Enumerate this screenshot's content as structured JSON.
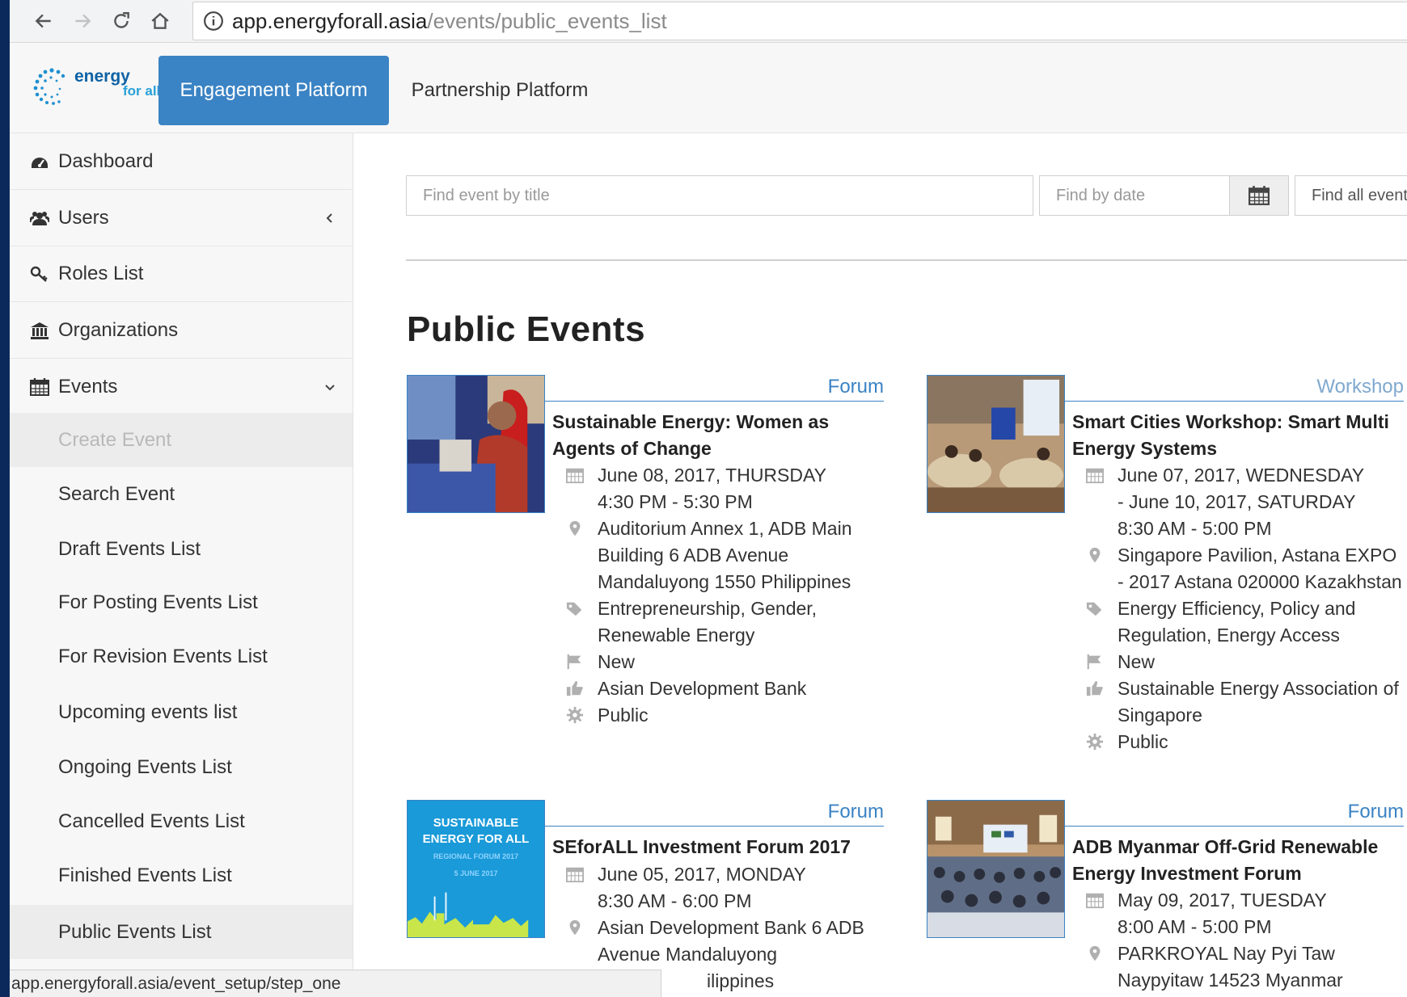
{
  "browser": {
    "url_host": "app.energyforall.asia",
    "url_path": "/events/public_events_list"
  },
  "topnav": {
    "logo_line1": "energy",
    "logo_line2": "for all",
    "tabs": [
      {
        "label": "Engagement Platform",
        "active": true
      },
      {
        "label": "Partnership Platform",
        "active": false
      }
    ]
  },
  "sidebar": {
    "items": [
      {
        "label": "Dashboard",
        "icon": "dashboard-icon"
      },
      {
        "label": "Users",
        "icon": "users-icon"
      },
      {
        "label": "Roles List",
        "icon": "key-icon"
      },
      {
        "label": "Organizations",
        "icon": "bank-icon"
      },
      {
        "label": "Events",
        "icon": "calendar-icon"
      }
    ],
    "events_sub": [
      "Create Event",
      "Search Event",
      "Draft Events List",
      "For Posting Events List",
      "For Revision Events List",
      "Upcoming events list",
      "Ongoing Events List",
      "Cancelled Events List",
      "Finished Events List",
      "Public Events List"
    ]
  },
  "filters": {
    "title_placeholder": "Find event by title",
    "date_placeholder": "Find by date",
    "all_events_label": "Find all event t"
  },
  "page": {
    "title": "Public Events"
  },
  "events": [
    {
      "category": "Forum",
      "title": "Sustainable Energy: Women as Agents of Change",
      "date": "June 08, 2017, THURSDAY",
      "time": "4:30 PM - 5:30 PM",
      "venue": "Auditorium Annex 1, ADB Main Building 6 ADB Avenue Mandaluyong 1550 Philippines",
      "tags": "Entrepreneurship, Gender, Renewable Energy",
      "status": "New",
      "organizer": "Asian Development Bank",
      "visibility": "Public"
    },
    {
      "category": "Workshop",
      "title": "Smart Cities Workshop: Smart Multi Energy Systems",
      "date": "June 07, 2017, WEDNESDAY",
      "date_end": "- June 10, 2017, SATURDAY",
      "time": "8:30 AM - 5:00 PM",
      "venue": "Singapore Pavilion, Astana EXPO - 2017 Astana 020000 Kazakhstan",
      "tags": "Energy Efficiency, Policy and Regulation, Energy Access",
      "status": "New",
      "organizer": "Sustainable Energy Association of Singapore",
      "visibility": "Public"
    },
    {
      "category": "Forum",
      "title": "SEforALL Investment Forum 2017",
      "date": "June 05, 2017, MONDAY",
      "time": "8:30 AM - 6:00 PM",
      "venue": "Asian Development Bank 6 ADB Avenue Mandaluyong",
      "venue_tail": "ilippines",
      "thumb_line1": "SUSTAINABLE",
      "thumb_line2": "ENERGY FOR ALL",
      "thumb_line3": "REGIONAL FORUM 2017",
      "thumb_line4": "5 JUNE 2017"
    },
    {
      "category": "Forum",
      "title": "ADB Myanmar Off-Grid Renewable Energy Investment Forum",
      "date": "May 09, 2017, TUESDAY",
      "time": "8:00 AM - 5:00 PM",
      "venue": "PARKROYAL Nay Pyi Taw Naypyitaw 14523 Myanmar"
    }
  ],
  "statusbar": {
    "text": "app.energyforall.asia/event_setup/step_one"
  },
  "colors": {
    "primary": "#3a83c4",
    "brand_blue": "#0e62a5",
    "desktop": "#0b2a5b"
  }
}
